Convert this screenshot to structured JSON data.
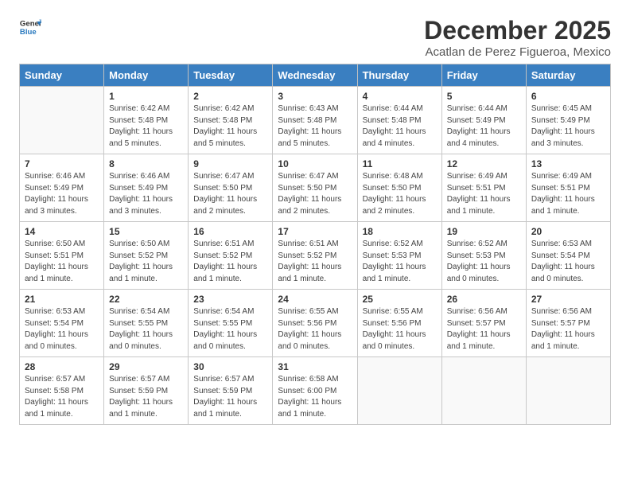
{
  "logo": {
    "general": "General",
    "blue": "Blue"
  },
  "title": "December 2025",
  "subtitle": "Acatlan de Perez Figueroa, Mexico",
  "days_of_week": [
    "Sunday",
    "Monday",
    "Tuesday",
    "Wednesday",
    "Thursday",
    "Friday",
    "Saturday"
  ],
  "weeks": [
    [
      {
        "num": "",
        "sunrise": "",
        "sunset": "",
        "daylight": ""
      },
      {
        "num": "1",
        "sunrise": "Sunrise: 6:42 AM",
        "sunset": "Sunset: 5:48 PM",
        "daylight": "Daylight: 11 hours and 5 minutes."
      },
      {
        "num": "2",
        "sunrise": "Sunrise: 6:42 AM",
        "sunset": "Sunset: 5:48 PM",
        "daylight": "Daylight: 11 hours and 5 minutes."
      },
      {
        "num": "3",
        "sunrise": "Sunrise: 6:43 AM",
        "sunset": "Sunset: 5:48 PM",
        "daylight": "Daylight: 11 hours and 5 minutes."
      },
      {
        "num": "4",
        "sunrise": "Sunrise: 6:44 AM",
        "sunset": "Sunset: 5:48 PM",
        "daylight": "Daylight: 11 hours and 4 minutes."
      },
      {
        "num": "5",
        "sunrise": "Sunrise: 6:44 AM",
        "sunset": "Sunset: 5:49 PM",
        "daylight": "Daylight: 11 hours and 4 minutes."
      },
      {
        "num": "6",
        "sunrise": "Sunrise: 6:45 AM",
        "sunset": "Sunset: 5:49 PM",
        "daylight": "Daylight: 11 hours and 3 minutes."
      }
    ],
    [
      {
        "num": "7",
        "sunrise": "Sunrise: 6:46 AM",
        "sunset": "Sunset: 5:49 PM",
        "daylight": "Daylight: 11 hours and 3 minutes."
      },
      {
        "num": "8",
        "sunrise": "Sunrise: 6:46 AM",
        "sunset": "Sunset: 5:49 PM",
        "daylight": "Daylight: 11 hours and 3 minutes."
      },
      {
        "num": "9",
        "sunrise": "Sunrise: 6:47 AM",
        "sunset": "Sunset: 5:50 PM",
        "daylight": "Daylight: 11 hours and 2 minutes."
      },
      {
        "num": "10",
        "sunrise": "Sunrise: 6:47 AM",
        "sunset": "Sunset: 5:50 PM",
        "daylight": "Daylight: 11 hours and 2 minutes."
      },
      {
        "num": "11",
        "sunrise": "Sunrise: 6:48 AM",
        "sunset": "Sunset: 5:50 PM",
        "daylight": "Daylight: 11 hours and 2 minutes."
      },
      {
        "num": "12",
        "sunrise": "Sunrise: 6:49 AM",
        "sunset": "Sunset: 5:51 PM",
        "daylight": "Daylight: 11 hours and 1 minute."
      },
      {
        "num": "13",
        "sunrise": "Sunrise: 6:49 AM",
        "sunset": "Sunset: 5:51 PM",
        "daylight": "Daylight: 11 hours and 1 minute."
      }
    ],
    [
      {
        "num": "14",
        "sunrise": "Sunrise: 6:50 AM",
        "sunset": "Sunset: 5:51 PM",
        "daylight": "Daylight: 11 hours and 1 minute."
      },
      {
        "num": "15",
        "sunrise": "Sunrise: 6:50 AM",
        "sunset": "Sunset: 5:52 PM",
        "daylight": "Daylight: 11 hours and 1 minute."
      },
      {
        "num": "16",
        "sunrise": "Sunrise: 6:51 AM",
        "sunset": "Sunset: 5:52 PM",
        "daylight": "Daylight: 11 hours and 1 minute."
      },
      {
        "num": "17",
        "sunrise": "Sunrise: 6:51 AM",
        "sunset": "Sunset: 5:52 PM",
        "daylight": "Daylight: 11 hours and 1 minute."
      },
      {
        "num": "18",
        "sunrise": "Sunrise: 6:52 AM",
        "sunset": "Sunset: 5:53 PM",
        "daylight": "Daylight: 11 hours and 1 minute."
      },
      {
        "num": "19",
        "sunrise": "Sunrise: 6:52 AM",
        "sunset": "Sunset: 5:53 PM",
        "daylight": "Daylight: 11 hours and 0 minutes."
      },
      {
        "num": "20",
        "sunrise": "Sunrise: 6:53 AM",
        "sunset": "Sunset: 5:54 PM",
        "daylight": "Daylight: 11 hours and 0 minutes."
      }
    ],
    [
      {
        "num": "21",
        "sunrise": "Sunrise: 6:53 AM",
        "sunset": "Sunset: 5:54 PM",
        "daylight": "Daylight: 11 hours and 0 minutes."
      },
      {
        "num": "22",
        "sunrise": "Sunrise: 6:54 AM",
        "sunset": "Sunset: 5:55 PM",
        "daylight": "Daylight: 11 hours and 0 minutes."
      },
      {
        "num": "23",
        "sunrise": "Sunrise: 6:54 AM",
        "sunset": "Sunset: 5:55 PM",
        "daylight": "Daylight: 11 hours and 0 minutes."
      },
      {
        "num": "24",
        "sunrise": "Sunrise: 6:55 AM",
        "sunset": "Sunset: 5:56 PM",
        "daylight": "Daylight: 11 hours and 0 minutes."
      },
      {
        "num": "25",
        "sunrise": "Sunrise: 6:55 AM",
        "sunset": "Sunset: 5:56 PM",
        "daylight": "Daylight: 11 hours and 0 minutes."
      },
      {
        "num": "26",
        "sunrise": "Sunrise: 6:56 AM",
        "sunset": "Sunset: 5:57 PM",
        "daylight": "Daylight: 11 hours and 1 minute."
      },
      {
        "num": "27",
        "sunrise": "Sunrise: 6:56 AM",
        "sunset": "Sunset: 5:57 PM",
        "daylight": "Daylight: 11 hours and 1 minute."
      }
    ],
    [
      {
        "num": "28",
        "sunrise": "Sunrise: 6:57 AM",
        "sunset": "Sunset: 5:58 PM",
        "daylight": "Daylight: 11 hours and 1 minute."
      },
      {
        "num": "29",
        "sunrise": "Sunrise: 6:57 AM",
        "sunset": "Sunset: 5:59 PM",
        "daylight": "Daylight: 11 hours and 1 minute."
      },
      {
        "num": "30",
        "sunrise": "Sunrise: 6:57 AM",
        "sunset": "Sunset: 5:59 PM",
        "daylight": "Daylight: 11 hours and 1 minute."
      },
      {
        "num": "31",
        "sunrise": "Sunrise: 6:58 AM",
        "sunset": "Sunset: 6:00 PM",
        "daylight": "Daylight: 11 hours and 1 minute."
      },
      {
        "num": "",
        "sunrise": "",
        "sunset": "",
        "daylight": ""
      },
      {
        "num": "",
        "sunrise": "",
        "sunset": "",
        "daylight": ""
      },
      {
        "num": "",
        "sunrise": "",
        "sunset": "",
        "daylight": ""
      }
    ]
  ]
}
